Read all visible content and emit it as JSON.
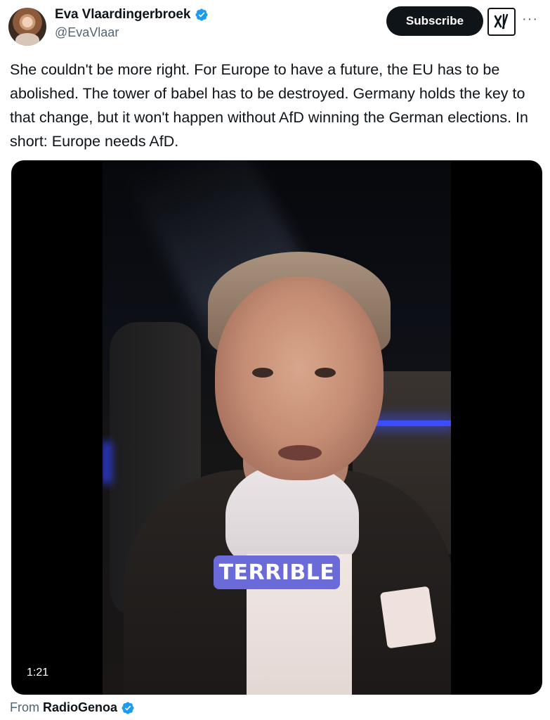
{
  "author": {
    "display_name": "Eva Vlaardingerbroek",
    "handle": "@EvaVlaar",
    "verified": true
  },
  "actions": {
    "subscribe_label": "Subscribe",
    "grok_icon": "grok-icon",
    "more_label": "···"
  },
  "tweet": {
    "text": "She couldn't be more right. For Europe to have a future, the EU has to be abolished. The tower of babel has to be destroyed. Germany holds the key to that change, but it won't happen without AfD winning the German elections. In short: Europe needs AfD."
  },
  "video": {
    "caption": "TERRIBLE",
    "duration": "1:21"
  },
  "attribution": {
    "prefix": "From",
    "source": "RadioGenoa",
    "verified": true
  },
  "colors": {
    "verified_blue": "#1d9bf0",
    "text_primary": "#0f1419",
    "text_secondary": "#536471",
    "caption_bg": "#6a6ad8"
  }
}
